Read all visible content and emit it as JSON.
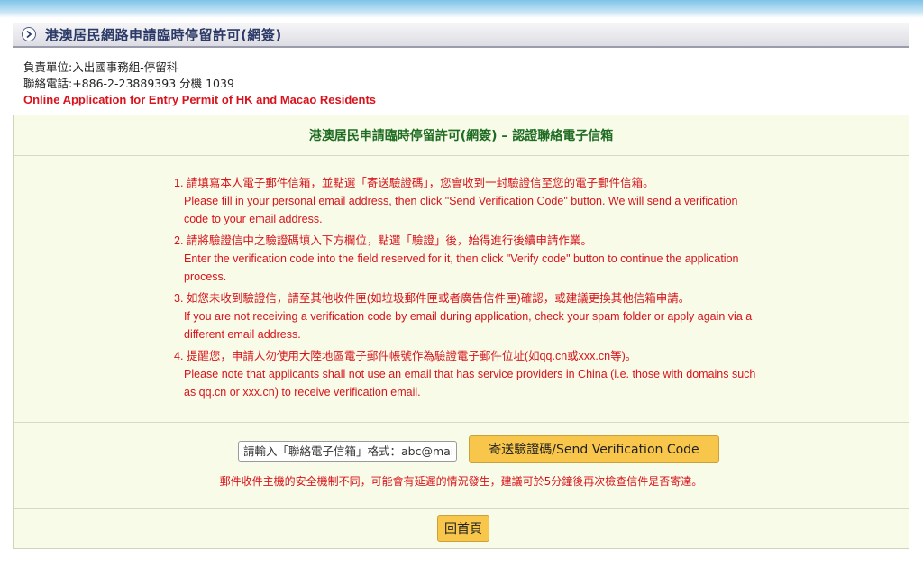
{
  "header": {
    "title": "港澳居民網路申請臨時停留許可(網簽)",
    "icon": "chevron-right-icon"
  },
  "info": {
    "unit": "負責單位:入出國事務組-停留科",
    "phone": "聯絡電話:+886-2-23889393 分機 1039",
    "en_title": "Online Application for Entry Permit of HK and Macao Residents"
  },
  "panel": {
    "title": "港澳居民申請臨時停留許可(網簽) – 認證聯絡電子信箱",
    "instructions": [
      {
        "zh": "1. 請填寫本人電子郵件信箱，並點選「寄送驗證碼」，您會收到一封驗證信至您的電子郵件信箱。",
        "en": "Please fill in your personal email address, then click \"Send Verification Code\" button. We will send a verification code to your email address."
      },
      {
        "zh": "2. 請將驗證信中之驗證碼填入下方欄位，點選「驗證」後，始得進行後續申請作業。",
        "en": "Enter the verification code into the field reserved for it, then click \"Verify code\" button to continue the application process."
      },
      {
        "zh": "3. 如您未收到驗證信，請至其他收件匣(如垃圾郵件匣或者廣告信件匣)確認，或建議更換其他信箱申請。",
        "en": "If you are not receiving a verification code by email during application, check your spam folder or apply again via a different email address."
      },
      {
        "zh": "4. 提醒您，申請人勿使用大陸地區電子郵件帳號作為驗證電子郵件位址(如qq.cn或xxx.cn等)。",
        "en": "Please note that applicants shall not use an email that has service providers in China (i.e. those with domains such as qq.cn or xxx.cn) to receive verification email."
      }
    ]
  },
  "form": {
    "email_placeholder": "請輸入「聯絡電子信箱」格式：abc@mail.com",
    "email_value": "",
    "send_label": "寄送驗證碼/Send Verification Code",
    "note": "郵件收件主機的安全機制不同，可能會有延遲的情況發生，建議可於5分鐘後再次檢查信件是否寄達。",
    "home_label": "回首頁"
  },
  "colors": {
    "accent_red": "#d9131b",
    "title_green": "#1e6b22",
    "button_yellow": "#f7c64a",
    "panel_bg": "#f8fbe8"
  }
}
